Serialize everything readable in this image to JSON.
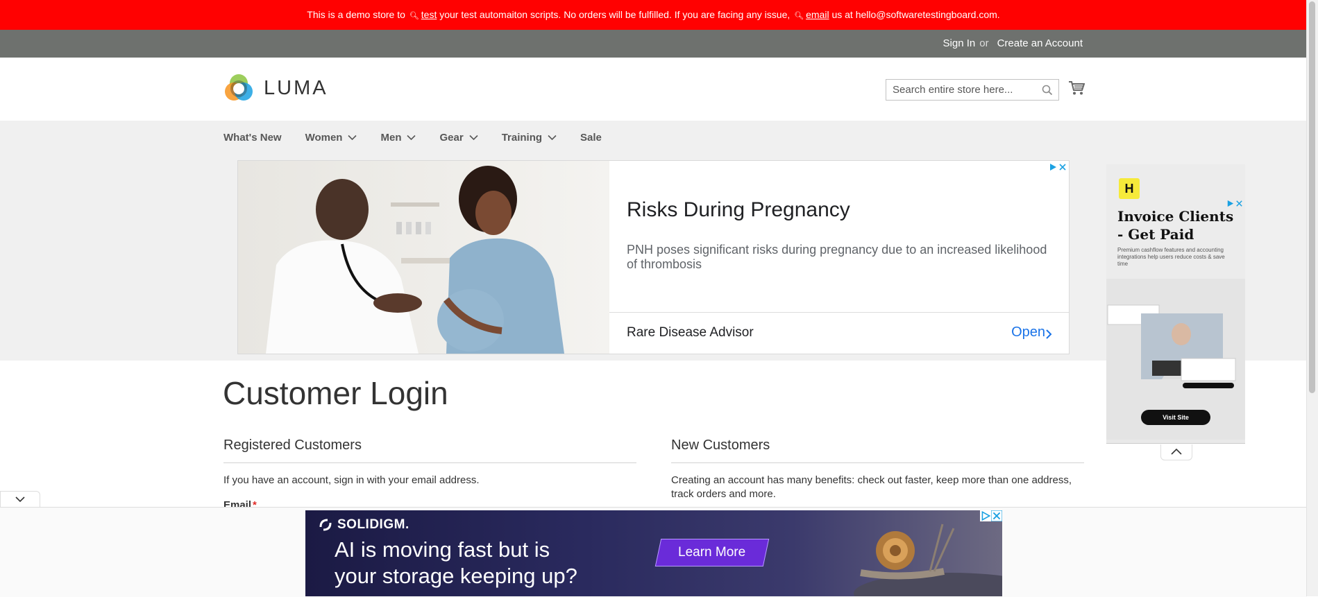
{
  "demo_notice": {
    "part1": "This is a demo store to",
    "link1": "test",
    "part2": "your test automaiton scripts. No orders will be fulfilled. If you are facing any issue,",
    "link2": "email",
    "part3": "us at hello@softwaretestingboard.com."
  },
  "account": {
    "sign_in": "Sign In",
    "or": "or",
    "create": "Create an Account"
  },
  "header": {
    "brand": "LUMA",
    "search_placeholder": "Search entire store here..."
  },
  "nav": {
    "items": [
      {
        "label": "What's New",
        "has_menu": false
      },
      {
        "label": "Women",
        "has_menu": true
      },
      {
        "label": "Men",
        "has_menu": true
      },
      {
        "label": "Gear",
        "has_menu": true
      },
      {
        "label": "Training",
        "has_menu": true
      },
      {
        "label": "Sale",
        "has_menu": false
      }
    ]
  },
  "ad_main": {
    "headline": "Risks During Pregnancy",
    "description": "PNH poses significant risks during pregnancy due to an increased likelihood of thrombosis",
    "advertiser": "Rare Disease Advisor",
    "cta": "Open"
  },
  "side_ad": {
    "logo_glyph": "H",
    "title": "Invoice Clients - Get Paid",
    "subtitle": "Premium cashflow features and accounting integrations help users reduce costs & save time",
    "cta": "Visit Site"
  },
  "login": {
    "page_title": "Customer Login",
    "registered_title": "Registered Customers",
    "registered_text": "If you have an account, sign in with your email address.",
    "email_label": "Email",
    "required_mark": "*",
    "new_title": "New Customers",
    "new_text": "Creating an account has many benefits: check out faster, keep more than one address, track orders and more."
  },
  "bottom_ad": {
    "brand": "SOLIDIGM.",
    "headline_line1": "AI is moving fast but is",
    "headline_line2": "your storage keeping up?",
    "cta": "Learn More"
  },
  "colors": {
    "demo_red": "#ff0101",
    "account_gray": "#6e716e",
    "nav_gray": "#f0f0f0",
    "link_blue": "#1a73e8",
    "required_red": "#e02b27"
  }
}
